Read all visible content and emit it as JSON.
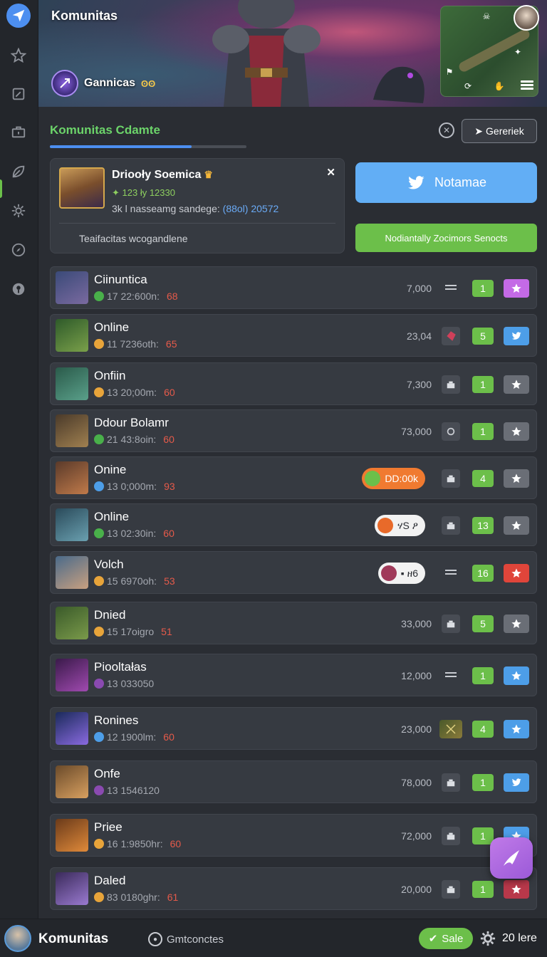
{
  "colors": {
    "accent_green": "#6cbf4a",
    "accent_blue": "#4d8ff0",
    "twitter_blue": "#62aef5",
    "level_red": "#e55a4a",
    "fab_purple": "#b06ae0"
  },
  "sidebar": {
    "items": [
      {
        "icon": "send-icon"
      },
      {
        "icon": "star-icon"
      },
      {
        "icon": "edit-icon"
      },
      {
        "icon": "briefcase-icon"
      },
      {
        "icon": "leaf-icon"
      },
      {
        "icon": "gear-icon"
      },
      {
        "icon": "compass-icon"
      },
      {
        "icon": "pin-icon"
      }
    ]
  },
  "banner": {
    "title": "Komunitas",
    "guild_name": "Gannicas",
    "guild_badge": "ʘʘ"
  },
  "section": {
    "title": "Komunitas Cdamte",
    "progress": 0.72,
    "generic_button": "Gereriek"
  },
  "profile": {
    "name": "Driooły Soemica",
    "stats": "123 ły 12330",
    "sub_prefix": "3k l nasseamg sandege: ",
    "sub_accent": "(88оl) 20572",
    "footer": "Teaifacitas wcogandlene"
  },
  "actions": {
    "twitter_label": "Notamae",
    "green_label": "Nodiantally Zocimors Senocts"
  },
  "members": [
    {
      "name": "Ciinuntica",
      "meta": "17 22:600n:",
      "level": "68",
      "score": "7,000",
      "count": "1",
      "coin": "#49b04a",
      "portrait": [
        "#3a4a78",
        "#7a6aa0"
      ],
      "mid": "menu",
      "action": "#c46ae6",
      "action_icon": "star-icon"
    },
    {
      "name": "Online",
      "meta": "11 7236oth:",
      "level": "65",
      "score": "23,04",
      "count": "5",
      "coin": "#e8a43a",
      "portrait": [
        "#2e5a2a",
        "#7aa04a"
      ],
      "mid": "gem",
      "action": "#4d9ee8",
      "action_icon": "bird-icon"
    },
    {
      "name": "Onfiin",
      "meta": "13 20;00m:",
      "level": "60",
      "score": "7,300",
      "count": "1",
      "coin": "#e8a43a",
      "portrait": [
        "#2a5a4a",
        "#5aa08a"
      ],
      "mid": "box",
      "action": "#6a6e76",
      "action_icon": "star-icon"
    },
    {
      "name": "Ddour Bolamr",
      "meta": "21 43:8oin:",
      "level": "60",
      "score": "73,000",
      "count": "1",
      "coin": "#49b04a",
      "portrait": [
        "#4a3a2a",
        "#a08050"
      ],
      "mid": "ring",
      "action": "#6a6e76",
      "action_icon": "star-icon"
    },
    {
      "name": "Onine",
      "meta": "13 0;000m:",
      "level": "93",
      "score": "",
      "count": "4",
      "coin": "#4d9ee8",
      "portrait": [
        "#5a3a2a",
        "#c07a4a"
      ],
      "mid": "box",
      "action": "#6a6e76",
      "action_icon": "star-icon",
      "pill": {
        "text": "DD:00k",
        "bg": "#f07a30",
        "fg": "#ffffff",
        "ball": "#6cbf4a"
      }
    },
    {
      "name": "Online",
      "meta": "13 02:30in:",
      "level": "60",
      "score": "",
      "count": "13",
      "coin": "#49b04a",
      "portrait": [
        "#2a4a5a",
        "#6aa0b0"
      ],
      "mid": "box",
      "action": "#6a6e76",
      "action_icon": "star-icon",
      "pill": {
        "text": "ሃS ዖ",
        "bg": "#f2f2f2",
        "fg": "#2a2d33",
        "ball": "#e86a2a"
      }
    },
    {
      "name": "Volch",
      "meta": "15 6970oh:",
      "level": "53",
      "score": "",
      "count": "16",
      "coin": "#e8a43a",
      "portrait": [
        "#4a6a8a",
        "#c8a080"
      ],
      "mid": "menu",
      "action": "#e0453a",
      "action_icon": "star-icon",
      "pill": {
        "text": "▪ ዘ6",
        "bg": "#f2f2f2",
        "fg": "#2a2d33",
        "ball": "#a03a5a"
      }
    },
    {
      "name": "Dnied",
      "meta": "15 17oigro",
      "level": "51",
      "score": "33,000",
      "count": "5",
      "coin": "#e8a43a",
      "portrait": [
        "#3a5a2a",
        "#7a9a4a"
      ],
      "mid": "box",
      "action": "#6a6e76",
      "action_icon": "star-icon"
    },
    {
      "name": "Piooltałas",
      "meta": "13 033050",
      "level": "",
      "score": "12,000",
      "count": "1",
      "coin": "#8a4ab0",
      "portrait": [
        "#3a1a4a",
        "#a04ab0"
      ],
      "mid": "menu",
      "action": "#4d9ee8",
      "action_icon": "star-icon"
    },
    {
      "name": "Ronines",
      "meta": "12 1900lm:",
      "level": "60",
      "score": "23,000",
      "count": "4",
      "coin": "#4d9ee8",
      "portrait": [
        "#1a2a5a",
        "#8a6ae0"
      ],
      "mid": "shard",
      "action": "#4d9ee8",
      "action_icon": "star-icon"
    },
    {
      "name": "Onfe",
      "meta": "13 1546120",
      "level": "",
      "score": "78,000",
      "count": "1",
      "coin": "#8a4ab0",
      "portrait": [
        "#6a4a2a",
        "#d8a060"
      ],
      "mid": "box",
      "action": "#4d9ee8",
      "action_icon": "bird-icon"
    },
    {
      "name": "Priee",
      "meta": "16 1:9850hr:",
      "level": "60",
      "score": "72,000",
      "count": "1",
      "coin": "#e8a43a",
      "portrait": [
        "#6a3a1a",
        "#e08a3a"
      ],
      "mid": "box",
      "action": "#4d9ee8",
      "action_icon": "star-icon"
    },
    {
      "name": "Daled",
      "meta": "83 0180ghr:",
      "level": "61",
      "score": "20,000",
      "count": "1",
      "coin": "#e8a43a",
      "portrait": [
        "#3a2a5a",
        "#9a7ad0"
      ],
      "mid": "box",
      "action": "#b8384a",
      "action_icon": "star-icon"
    }
  ],
  "bottombar": {
    "title": "Komunitas",
    "link": "Gmtconctes",
    "sale": "Sale",
    "count": "20 lere"
  }
}
